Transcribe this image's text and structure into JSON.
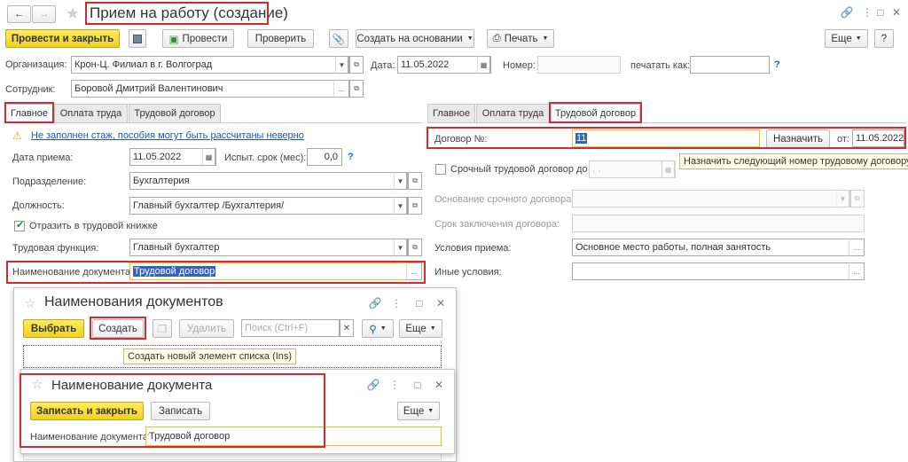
{
  "window": {
    "title": "Прием на работу (создание)"
  },
  "toolbar": {
    "post_close": "Провести и закрыть",
    "post": "Провести",
    "check": "Проверить",
    "create_based": "Создать на основании",
    "print": "Печать",
    "more": "Еще",
    "help": "?"
  },
  "header": {
    "org_label": "Организация:",
    "org_value": "Крон-Ц. Филиал в г. Волгоград",
    "date_label": "Дата:",
    "date_value": "11.05.2022",
    "number_label": "Номер:",
    "print_as_label": "печатать как:",
    "help": "?",
    "employee_label": "Сотрудник:",
    "employee_value": "Боровой Дмитрий Валентинович"
  },
  "left_tabs": [
    "Главное",
    "Оплата труда",
    "Трудовой договор"
  ],
  "main": {
    "warning": "Не заполнен стаж, пособия могут быть рассчитаны неверно",
    "hire_date_label": "Дата приема:",
    "hire_date_value": "11.05.2022",
    "probation_label": "Испыт. срок (мес):",
    "probation_value": "0,0",
    "help": "?",
    "dept_label": "Подразделение:",
    "dept_value": "Бухгалтерия",
    "position_label": "Должность:",
    "position_value": "Главный бухгалтер /Бухгалтерия/",
    "workbook_label": "Отразить в трудовой книжке",
    "function_label": "Трудовая функция:",
    "function_value": "Главный бухгалтер",
    "docname_label": "Наименование документа:",
    "docname_value": "Трудовой договор"
  },
  "right_tabs": [
    "Главное",
    "Оплата труда",
    "Трудовой договор"
  ],
  "contract": {
    "number_label": "Договор №:",
    "number_value": "11",
    "assign": "Назначить",
    "from_label": "от:",
    "from_value": "11.05.2022",
    "tooltip": "Назначить следующий номер трудовому договору",
    "fixed_term_label": "Срочный трудовой договор до",
    "fixed_term_value": ". .",
    "basis_label": "Основание срочного договора:",
    "conclusion_label": "Срок заключения договора:",
    "conditions_label": "Условия приема:",
    "conditions_value": "Основное место работы, полная занятость",
    "other_label": "Иные условия:"
  },
  "list_dialog": {
    "title": "Наименования документов",
    "select": "Выбрать",
    "create": "Создать",
    "delete": "Удалить",
    "search_placeholder": "Поиск (Ctrl+F)",
    "more": "Еще",
    "tooltip": "Создать новый элемент списка (Ins)"
  },
  "item_dialog": {
    "title": "Наименование документа",
    "save_close": "Записать и закрыть",
    "save": "Записать",
    "more": "Еще",
    "name_label": "Наименование документа:",
    "name_value": "Трудовой договор"
  },
  "colors": {
    "accent_yellow": "#f3d42d",
    "highlight_red": "#d7282f",
    "link_blue": "#1a57b5"
  }
}
